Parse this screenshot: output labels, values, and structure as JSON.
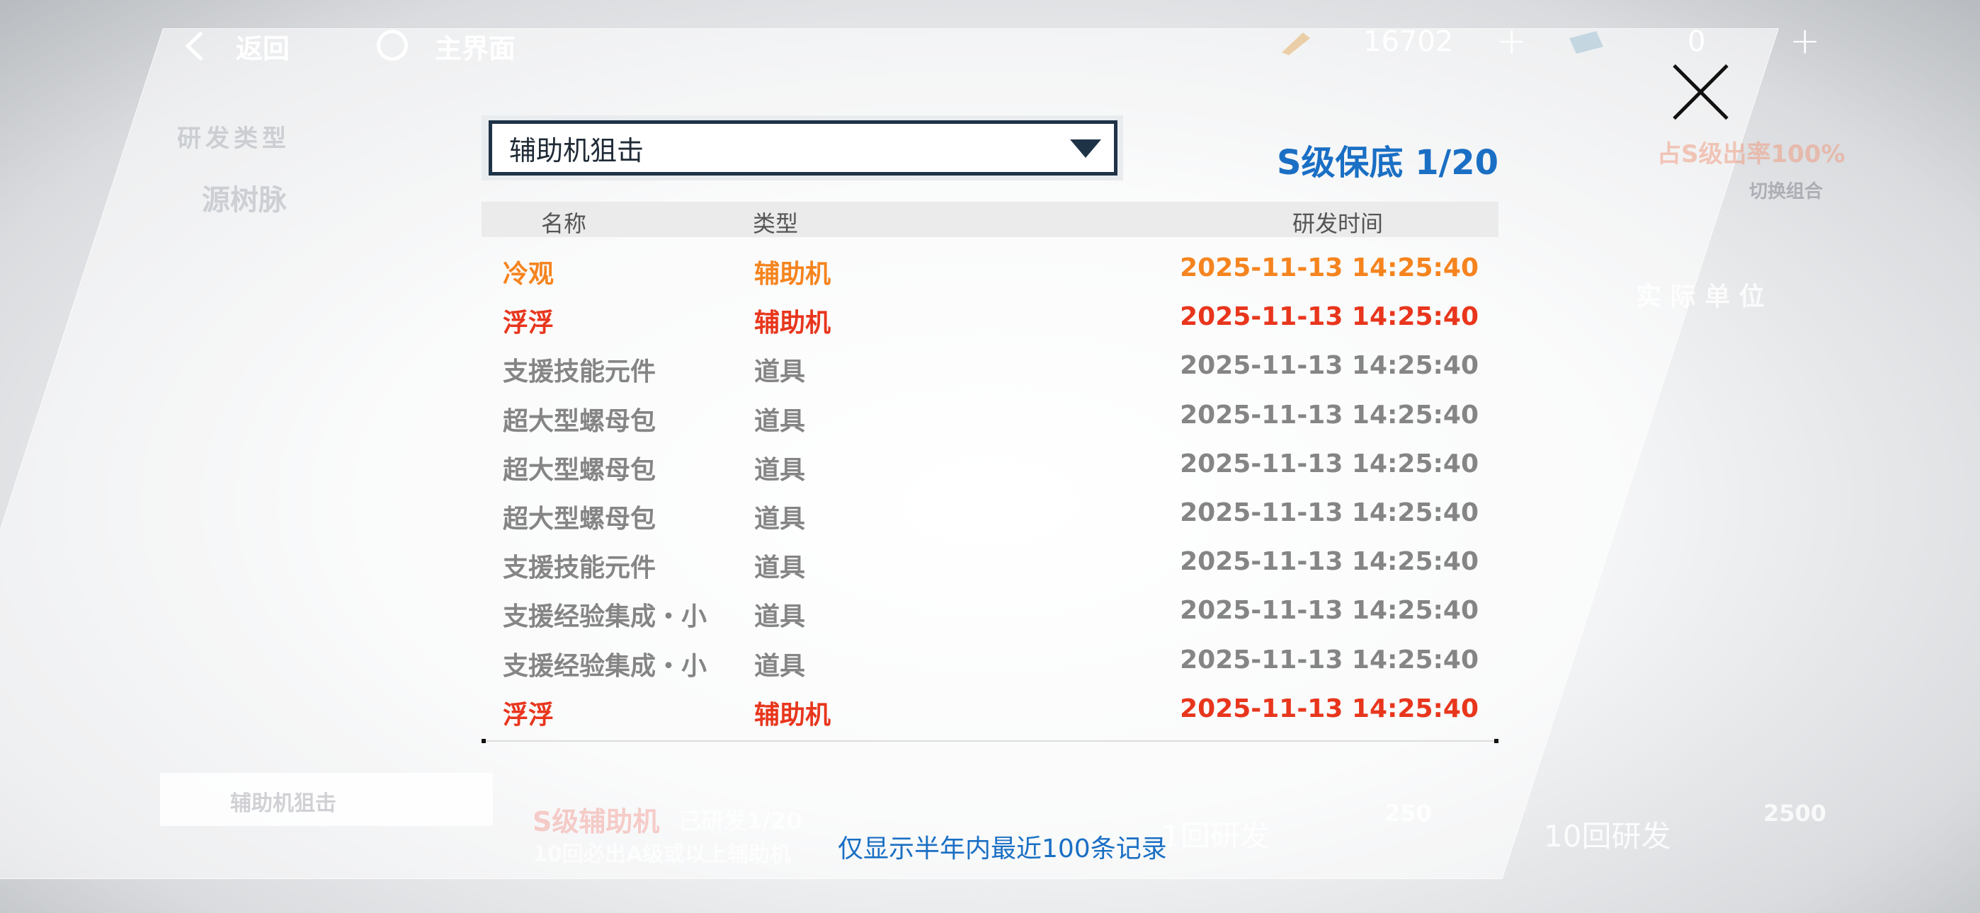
{
  "topbar": {
    "back_label": "返回",
    "home_label": "主界面",
    "currency1_value": "16702",
    "currency2_value": "0",
    "plus_label": "+"
  },
  "background": {
    "category_label": "研发类型",
    "side_label": "源树脉",
    "pool_label": "辅助机狙击",
    "rate_label": "占S级出率100%",
    "switch_label": "切换组合",
    "unit_label": "实 际 单 位",
    "s_grade_label": "S级辅助机",
    "researched_label": "已研发1/20",
    "guarantee_label": "10回必出A级或以上辅助机",
    "draw1_label": "1回研发",
    "draw1_cost": "250",
    "draw10_label": "10回研发",
    "draw10_cost": "2500"
  },
  "modal": {
    "dropdown_value": "辅助机狙击",
    "pity_text": "S级保底 1/20",
    "columns": [
      "名称",
      "类型",
      "研发时间"
    ],
    "rows": [
      {
        "name": "冷观",
        "type": "辅助机",
        "time": "2025-11-13 14:25:40",
        "color": "#f5841f"
      },
      {
        "name": "浮浮",
        "type": "辅助机",
        "time": "2025-11-13 14:25:40",
        "color": "#e8361d"
      },
      {
        "name": "支援技能元件",
        "type": "道具",
        "time": "2025-11-13 14:25:40",
        "color": "#858585"
      },
      {
        "name": "超大型螺母包",
        "type": "道具",
        "time": "2025-11-13 14:25:40",
        "color": "#858585"
      },
      {
        "name": "超大型螺母包",
        "type": "道具",
        "time": "2025-11-13 14:25:40",
        "color": "#858585"
      },
      {
        "name": "超大型螺母包",
        "type": "道具",
        "time": "2025-11-13 14:25:40",
        "color": "#858585"
      },
      {
        "name": "支援技能元件",
        "type": "道具",
        "time": "2025-11-13 14:25:40",
        "color": "#858585"
      },
      {
        "name": "支援经验集成・小",
        "type": "道具",
        "time": "2025-11-13 14:25:40",
        "color": "#858585"
      },
      {
        "name": "支援经验集成・小",
        "type": "道具",
        "time": "2025-11-13 14:25:40",
        "color": "#858585"
      },
      {
        "name": "浮浮",
        "type": "辅助机",
        "time": "2025-11-13 14:25:40",
        "color": "#e8361d"
      }
    ],
    "footer_note": "仅显示半年内最近100条记录"
  }
}
